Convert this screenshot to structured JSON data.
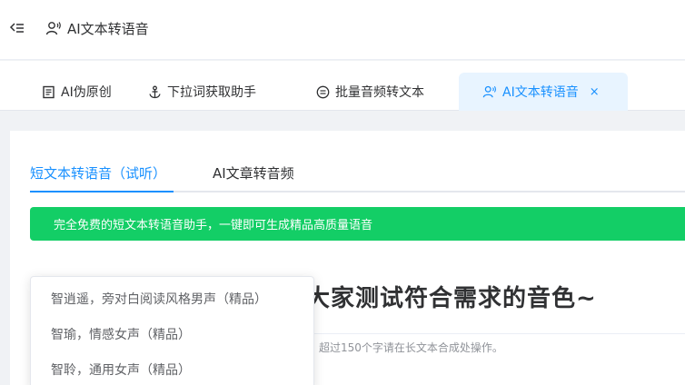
{
  "header": {
    "title": "AI文本转语音",
    "collapse_icon": "menu-fold-icon",
    "title_icon": "voice-user-icon"
  },
  "tabs": [
    {
      "label": "AI伪原创",
      "icon": "document-icon"
    },
    {
      "label": "下拉词获取助手",
      "icon": "anchor-icon"
    },
    {
      "label": "批量音频转文本",
      "icon": "convert-circle-icon"
    },
    {
      "label": "AI文本转语音",
      "icon": "voice-user-icon",
      "active": true,
      "close": "×"
    }
  ],
  "subtabs": [
    {
      "label": "短文本转语音（试听）",
      "active": true
    },
    {
      "label": "AI文章转音频"
    }
  ],
  "notice": "完全免费的短文本转语音助手，一键即可生成精品高质量语音",
  "main": {
    "title": "大家测试符合需求的音色~",
    "hint": "超过150个字请在长文本合成处操作。"
  },
  "voice_dropdown": {
    "options": [
      "智逍遥，旁对白阅读风格男声（精品）",
      "智瑜，情感女声（精品）",
      "智聆，通用女声（精品）"
    ]
  },
  "colors": {
    "accent": "#1890ff",
    "success": "#13ce66",
    "active_tab_bg": "#e8f4ff"
  }
}
